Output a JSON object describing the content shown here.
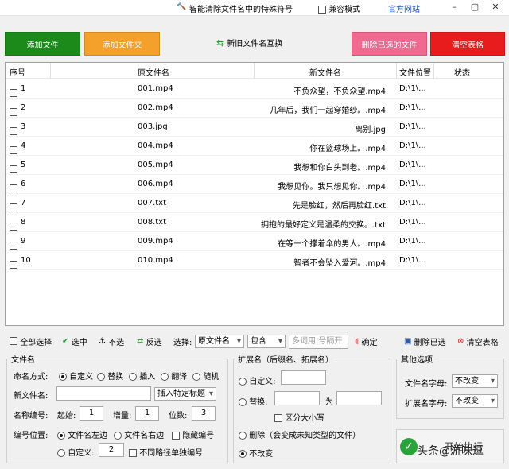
{
  "title": "智能清除文件名中的特殊符号",
  "compat_label": "兼容模式",
  "website_label": "官方网站",
  "window": {
    "min": "–",
    "max": "▢",
    "close": "✕"
  },
  "buttons": {
    "add_file": "添加文件",
    "add_folder": "添加文件夹",
    "swap_names": "新旧文件名互换",
    "delete_selected": "删除已选的文件",
    "clear_table": "清空表格"
  },
  "colors": {
    "green": "#1b8a1b",
    "orange": "#f4a12c",
    "pink": "#f06a8f",
    "red": "#e81c1c"
  },
  "table": {
    "headers": [
      "序号",
      "原文件名",
      "新文件名",
      "文件位置",
      "状态"
    ],
    "rows": [
      {
        "num": "1",
        "old": "001.mp4",
        "new": "不负众望，不负众望.mp4",
        "loc": "D:\\1\\..."
      },
      {
        "num": "2",
        "old": "002.mp4",
        "new": "几年后，我们一起穿婚纱。.mp4",
        "loc": "D:\\1\\..."
      },
      {
        "num": "3",
        "old": "003.jpg",
        "new": "离别.jpg",
        "loc": "D:\\1\\..."
      },
      {
        "num": "4",
        "old": "004.mp4",
        "new": "你在篮球场上。.mp4",
        "loc": "D:\\1\\..."
      },
      {
        "num": "5",
        "old": "005.mp4",
        "new": "我想和你白头到老。.mp4",
        "loc": "D:\\1\\..."
      },
      {
        "num": "6",
        "old": "006.mp4",
        "new": "我想见你。我只想见你。.mp4",
        "loc": "D:\\1\\..."
      },
      {
        "num": "7",
        "old": "007.txt",
        "new": "先是脸红，然后再脸红.txt",
        "loc": "D:\\1\\..."
      },
      {
        "num": "8",
        "old": "008.txt",
        "new": "拥抱的最好定义是温柔的交换。.txt",
        "loc": "D:\\1\\..."
      },
      {
        "num": "9",
        "old": "009.mp4",
        "new": "在等一个撑着伞的男人。.mp4",
        "loc": "D:\\1\\..."
      },
      {
        "num": "10",
        "old": "010.mp4",
        "new": "智者不会坠入爱河。.mp4",
        "loc": "D:\\1\\..."
      }
    ]
  },
  "toolbar": {
    "select_all": "全部选择",
    "select": "选中",
    "deselect": "不选",
    "invert": "反选",
    "choose": "选择:",
    "field_value": "原文件名",
    "match_value": "包含",
    "keyword_placeholder": "多词用|号隔开",
    "confirm": "确定",
    "delete_selected": "删除已选",
    "clear_table": "清空表格"
  },
  "filename_panel": {
    "legend": "文件名",
    "naming_mode": "命名方式:",
    "modes": [
      "自定义",
      "替换",
      "插入",
      "翻译",
      "随机"
    ],
    "new_name_label": "新文件名:",
    "insert_title": "插入特定标题",
    "numbering_label": "名称编号:",
    "start_label": "起始:",
    "start_value": "1",
    "increment_label": "增量:",
    "increment_value": "1",
    "digits_label": "位数:",
    "digits_value": "3",
    "position_label": "编号位置:",
    "pos_left": "文件名左边",
    "pos_right": "文件名右边",
    "hide_number": "隐藏编号",
    "pos_custom": "自定义:",
    "custom_value": "2",
    "separate_paths": "不同路径单独编号"
  },
  "ext_panel": {
    "legend": "扩展名（后缀名、拓展名）",
    "custom": "自定义:",
    "replace": "替换:",
    "to": "为",
    "case": "区分大小写",
    "delete": "删除（会变成未知类型的文件）",
    "nochange": "不改变"
  },
  "other_panel": {
    "legend": "其他选项",
    "filename_case": "文件名字母:",
    "filename_case_value": "不改变",
    "ext_case": "扩展名字母:",
    "ext_case_value": "不改变"
  },
  "start_label": "开始执行",
  "watermark": "头条@游味逗"
}
